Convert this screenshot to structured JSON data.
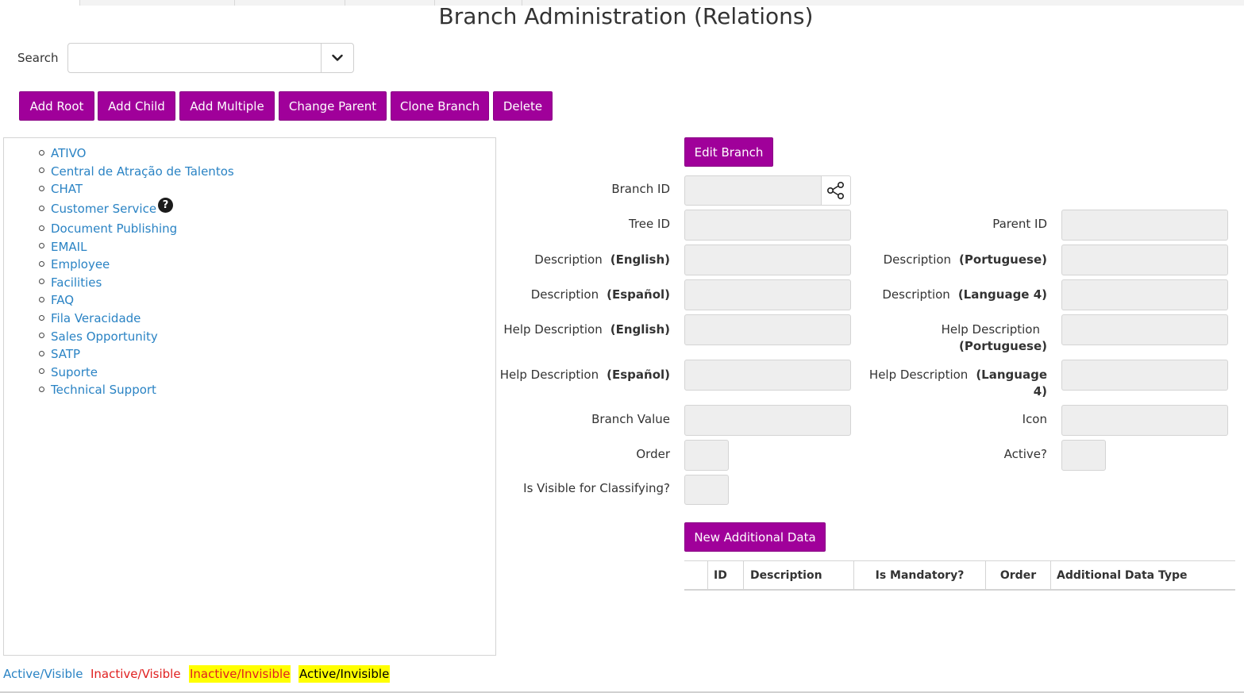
{
  "page": {
    "title": "Branch Administration (Relations)"
  },
  "search": {
    "label": "Search",
    "value": "",
    "toggle_icon": "chevron-down-icon"
  },
  "toolbar": {
    "add_root": "Add Root",
    "add_child": "Add Child",
    "add_multiple": "Add Multiple",
    "change_parent": "Change Parent",
    "clone_branch": "Clone Branch",
    "delete": "Delete"
  },
  "tree": {
    "items": [
      {
        "label": "ATIVO"
      },
      {
        "label": "Central de Atração de Talentos"
      },
      {
        "label": "CHAT"
      },
      {
        "label": "Customer Service",
        "help_icon": "?"
      },
      {
        "label": "Document Publishing"
      },
      {
        "label": "EMAIL"
      },
      {
        "label": "Employee"
      },
      {
        "label": "Facilities"
      },
      {
        "label": "FAQ"
      },
      {
        "label": "Fila Veracidade"
      },
      {
        "label": "Sales Opportunity"
      },
      {
        "label": "SATP"
      },
      {
        "label": "Suporte"
      },
      {
        "label": "Technical Support"
      }
    ]
  },
  "legend": {
    "active_visible": "Active/Visible",
    "inactive_visible": "Inactive/Visible",
    "inactive_invisible": "Inactive/Invisible",
    "active_invisible": "Active/Invisible"
  },
  "form": {
    "edit_branch": "Edit Branch",
    "branch_id": "Branch ID",
    "tree_id": "Tree ID",
    "parent_id": "Parent ID",
    "description": "Description",
    "help_description": "Help Description",
    "lang_english": "(English)",
    "lang_portuguese": "(Portuguese)",
    "lang_espanol": "(Español)",
    "lang_language4": "(Language 4)",
    "lang_language4_line1": "(Language",
    "lang_language4_line2": "4)",
    "branch_value": "Branch Value",
    "icon": "Icon",
    "order": "Order",
    "active": "Active?",
    "is_visible": "Is Visible for Classifying?",
    "new_additional_data": "New Additional Data"
  },
  "additional_table": {
    "columns": [
      "",
      "ID",
      "Description",
      "Is Mandatory?",
      "Order",
      "Additional Data Type"
    ]
  }
}
